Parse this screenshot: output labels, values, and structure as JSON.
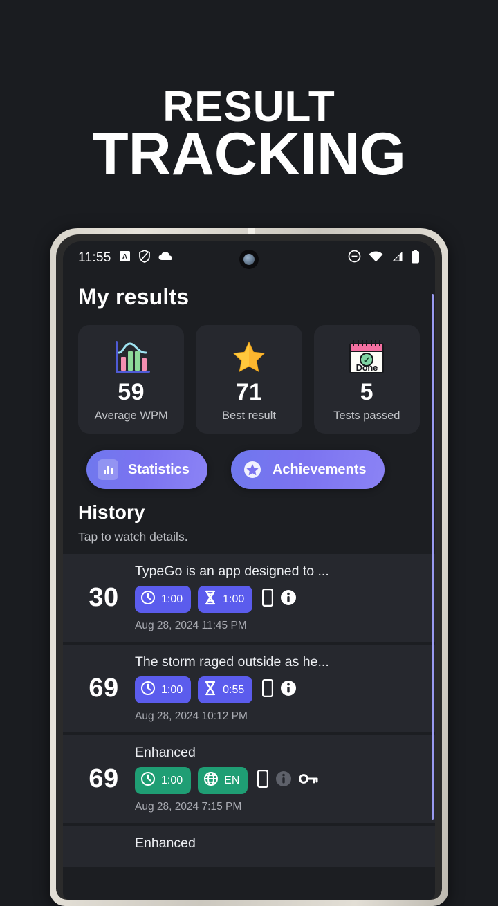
{
  "promo": {
    "line1": "RESULT",
    "line2": "TRACKING"
  },
  "statusbar": {
    "time": "11:55",
    "left_icons": [
      "app-badge-icon",
      "shield-icon",
      "cloud-icon"
    ],
    "right_icons": [
      "do-not-disturb-icon",
      "wifi-icon",
      "cellular-signal-icon",
      "battery-icon"
    ]
  },
  "app": {
    "title": "My results",
    "stats": [
      {
        "emoji": "bar-chart-emoji",
        "value": "59",
        "label": "Average WPM"
      },
      {
        "emoji": "star-emoji",
        "value": "71",
        "label": "Best result"
      },
      {
        "emoji": "calendar-done-emoji",
        "value": "5",
        "label": "Tests passed"
      }
    ],
    "actions": [
      {
        "icon": "bar-chart-icon",
        "label": "Statistics"
      },
      {
        "icon": "star-badge-icon",
        "label": "Achievements"
      }
    ],
    "history": {
      "title": "History",
      "subtitle": "Tap to watch details.",
      "rows": [
        {
          "score": "30",
          "text": "TypeGo is an app designed to ...",
          "chips": [
            {
              "icon": "clock-icon",
              "label": "1:00",
              "color": "blue"
            },
            {
              "icon": "hourglass-icon",
              "label": "1:00",
              "color": "blue"
            }
          ],
          "icons": [
            "phone-icon",
            "info-icon"
          ],
          "date": "Aug 28, 2024 11:45 PM"
        },
        {
          "score": "69",
          "text": "The storm raged outside as he...",
          "chips": [
            {
              "icon": "clock-icon",
              "label": "1:00",
              "color": "blue"
            },
            {
              "icon": "hourglass-icon",
              "label": "0:55",
              "color": "blue"
            }
          ],
          "icons": [
            "phone-icon",
            "info-icon"
          ],
          "date": "Aug 28, 2024 10:12 PM"
        },
        {
          "score": "69",
          "text": "Enhanced",
          "chips": [
            {
              "icon": "clock-icon",
              "label": "1:00",
              "color": "green"
            },
            {
              "icon": "globe-icon",
              "label": "EN",
              "color": "green"
            }
          ],
          "icons": [
            "phone-icon",
            "info-icon-dim",
            "key-icon"
          ],
          "date": "Aug 28, 2024 7:15 PM"
        },
        {
          "score": "",
          "text": "Enhanced",
          "chips": [],
          "icons": [],
          "date": ""
        }
      ]
    }
  },
  "colors": {
    "page_background": "#1a1c20",
    "screen_background": "#1c1e22",
    "card_background": "#26282e",
    "accent_purple": "#7b73f0",
    "chip_blue": "#5b5ced",
    "chip_green": "#1f9e74",
    "text_primary": "#ffffff",
    "text_secondary": "#bdbfc4",
    "scrollbar": "#9a9af0"
  }
}
